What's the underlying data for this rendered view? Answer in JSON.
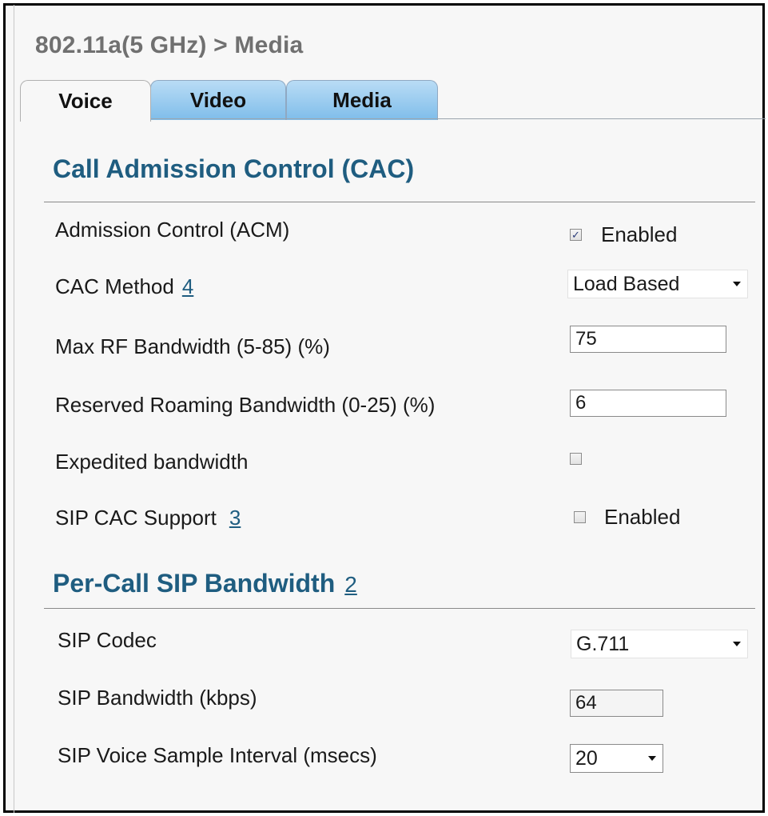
{
  "breadcrumb": "802.11a(5 GHz) > Media",
  "tabs": [
    {
      "label": "Voice",
      "active": true
    },
    {
      "label": "Video",
      "active": false
    },
    {
      "label": "Media",
      "active": false
    }
  ],
  "cac_section": {
    "title": "Call Admission Control (CAC)",
    "admission_control": {
      "label": "Admission Control (ACM)",
      "checked": true,
      "checkbox_label": "Enabled"
    },
    "cac_method": {
      "label": "CAC Method",
      "footnote": "4",
      "value": "Load Based"
    },
    "max_rf_bandwidth": {
      "label": "Max RF Bandwidth (5-85) (%)",
      "value": "75"
    },
    "reserved_roaming": {
      "label": "Reserved Roaming Bandwidth (0-25) (%)",
      "value": "6"
    },
    "expedited": {
      "label": "Expedited bandwidth",
      "checked": false
    },
    "sip_cac": {
      "label": "SIP CAC Support",
      "footnote": "3",
      "checked": false,
      "checkbox_label": "Enabled"
    }
  },
  "sip_section": {
    "title": "Per-Call SIP Bandwidth",
    "footnote": "2",
    "sip_codec": {
      "label": "SIP Codec",
      "value": "G.711"
    },
    "sip_bandwidth": {
      "label": "SIP Bandwidth (kbps)",
      "value": "64"
    },
    "sample_interval": {
      "label": "SIP Voice Sample Interval (msecs)",
      "value": "20"
    }
  },
  "colors": {
    "section_title": "#1f5d80",
    "tab_inactive": "#8fc6ee",
    "checkmark": "#2b3c7a"
  }
}
